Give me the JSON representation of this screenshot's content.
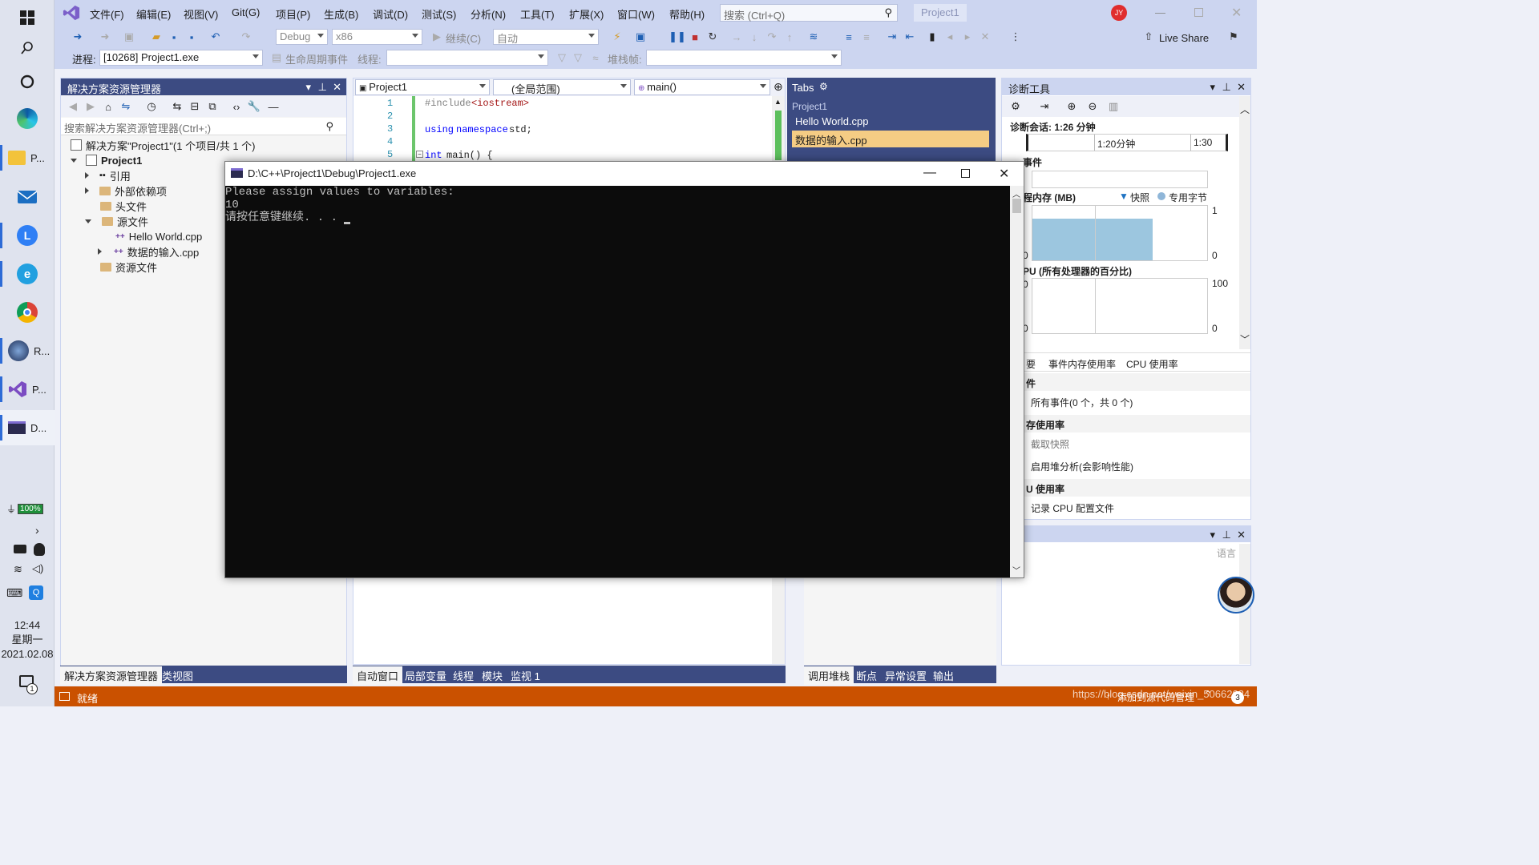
{
  "taskbar": {
    "apps": [
      {
        "label": "P..."
      },
      {
        "label": "R..."
      },
      {
        "label": "P..."
      },
      {
        "label": "D..."
      }
    ],
    "battery": "100%",
    "time": "12:44",
    "weekday": "星期一",
    "date": "2021.02.08",
    "notif_count": "1"
  },
  "menu": {
    "items": [
      "文件(F)",
      "编辑(E)",
      "视图(V)",
      "Git(G)",
      "项目(P)",
      "生成(B)",
      "调试(D)",
      "测试(S)",
      "分析(N)",
      "工具(T)",
      "扩展(X)",
      "窗口(W)",
      "帮助(H)"
    ],
    "search_placeholder": "搜索 (Ctrl+Q)",
    "project_badge": "Project1",
    "user_initials": "JY",
    "live_share": "Live Share"
  },
  "toolbar": {
    "config": "Debug",
    "platform": "x86",
    "continue": "继续(C)",
    "auto": "自动",
    "process_label": "进程:",
    "process_value": "[10268] Project1.exe",
    "lifecycle": "生命周期事件",
    "thread_label": "线程:",
    "stack_label": "堆栈帧:"
  },
  "solution_explorer": {
    "title": "解决方案资源管理器",
    "search_placeholder": "搜索解决方案资源管理器(Ctrl+;)",
    "solution": "解决方案\"Project1\"(1 个项目/共 1 个)",
    "project": "Project1",
    "nodes": {
      "refs": "引用",
      "external": "外部依赖项",
      "headers": "头文件",
      "sources": "源文件",
      "file1": "Hello World.cpp",
      "file2": "数据的输入.cpp",
      "resources": "资源文件"
    },
    "bottom_tabs": [
      "解决方案资源管理器",
      "类视图"
    ]
  },
  "editor": {
    "project_combo": "Project1",
    "scope_combo": "(全局范围)",
    "func_combo": "main()",
    "line_numbers": [
      "1",
      "2",
      "3",
      "4",
      "5"
    ],
    "line1_pre": "#include",
    "line1_lib": "<iostream>",
    "line3_kw1": "using",
    "line3_kw2": "namespace",
    "line3_rest": "std;",
    "line5_kw": "int",
    "line5_rest": "main() {"
  },
  "tabs_panel": {
    "title": "Tabs",
    "group": "Project1",
    "items": [
      "Hello World.cpp",
      "数据的输入.cpp"
    ]
  },
  "diagnostics": {
    "title": "诊断工具",
    "session": "诊断会话: 1:26 分钟",
    "timeline_ticks": [
      "1:20分钟",
      "1:30"
    ],
    "events_header": "事件",
    "memory_header": "程内存 (MB)",
    "legend": [
      "快照",
      "专用字节"
    ],
    "mem_max": "1",
    "mem_min": "0",
    "left_zero": "0",
    "cpu_header": "PU (所有处理器的百分比)",
    "cpu_max": "100",
    "cpu_min": "0",
    "tabs": [
      "要",
      "事件",
      "内存使用率",
      "CPU 使用率"
    ],
    "section_events": "件",
    "all_events": "所有事件(0 个，共 0 个)",
    "section_memory": "存使用率",
    "snapshot": "截取快照",
    "heap": "启用堆分析(会影响性能)",
    "section_cpu": "U 使用率",
    "cpu_profile": "记录 CPU 配置文件",
    "lang_label": "语言"
  },
  "bottom_left_tabs": [
    "自动窗口",
    "局部变量",
    "线程",
    "模块",
    "监视 1"
  ],
  "bottom_right_tabs": [
    "调用堆栈",
    "断点",
    "异常设置",
    "输出"
  ],
  "console": {
    "title": "D:\\C++\\Project1\\Debug\\Project1.exe",
    "lines": [
      "Please assign values to variables:",
      "10",
      "请按任意键继续. . . "
    ]
  },
  "status": {
    "text": "就绪",
    "watermark": "https://blog.csdn.net/weixin_50662034",
    "add_source": "添加到源代码管理",
    "badge": "3"
  }
}
